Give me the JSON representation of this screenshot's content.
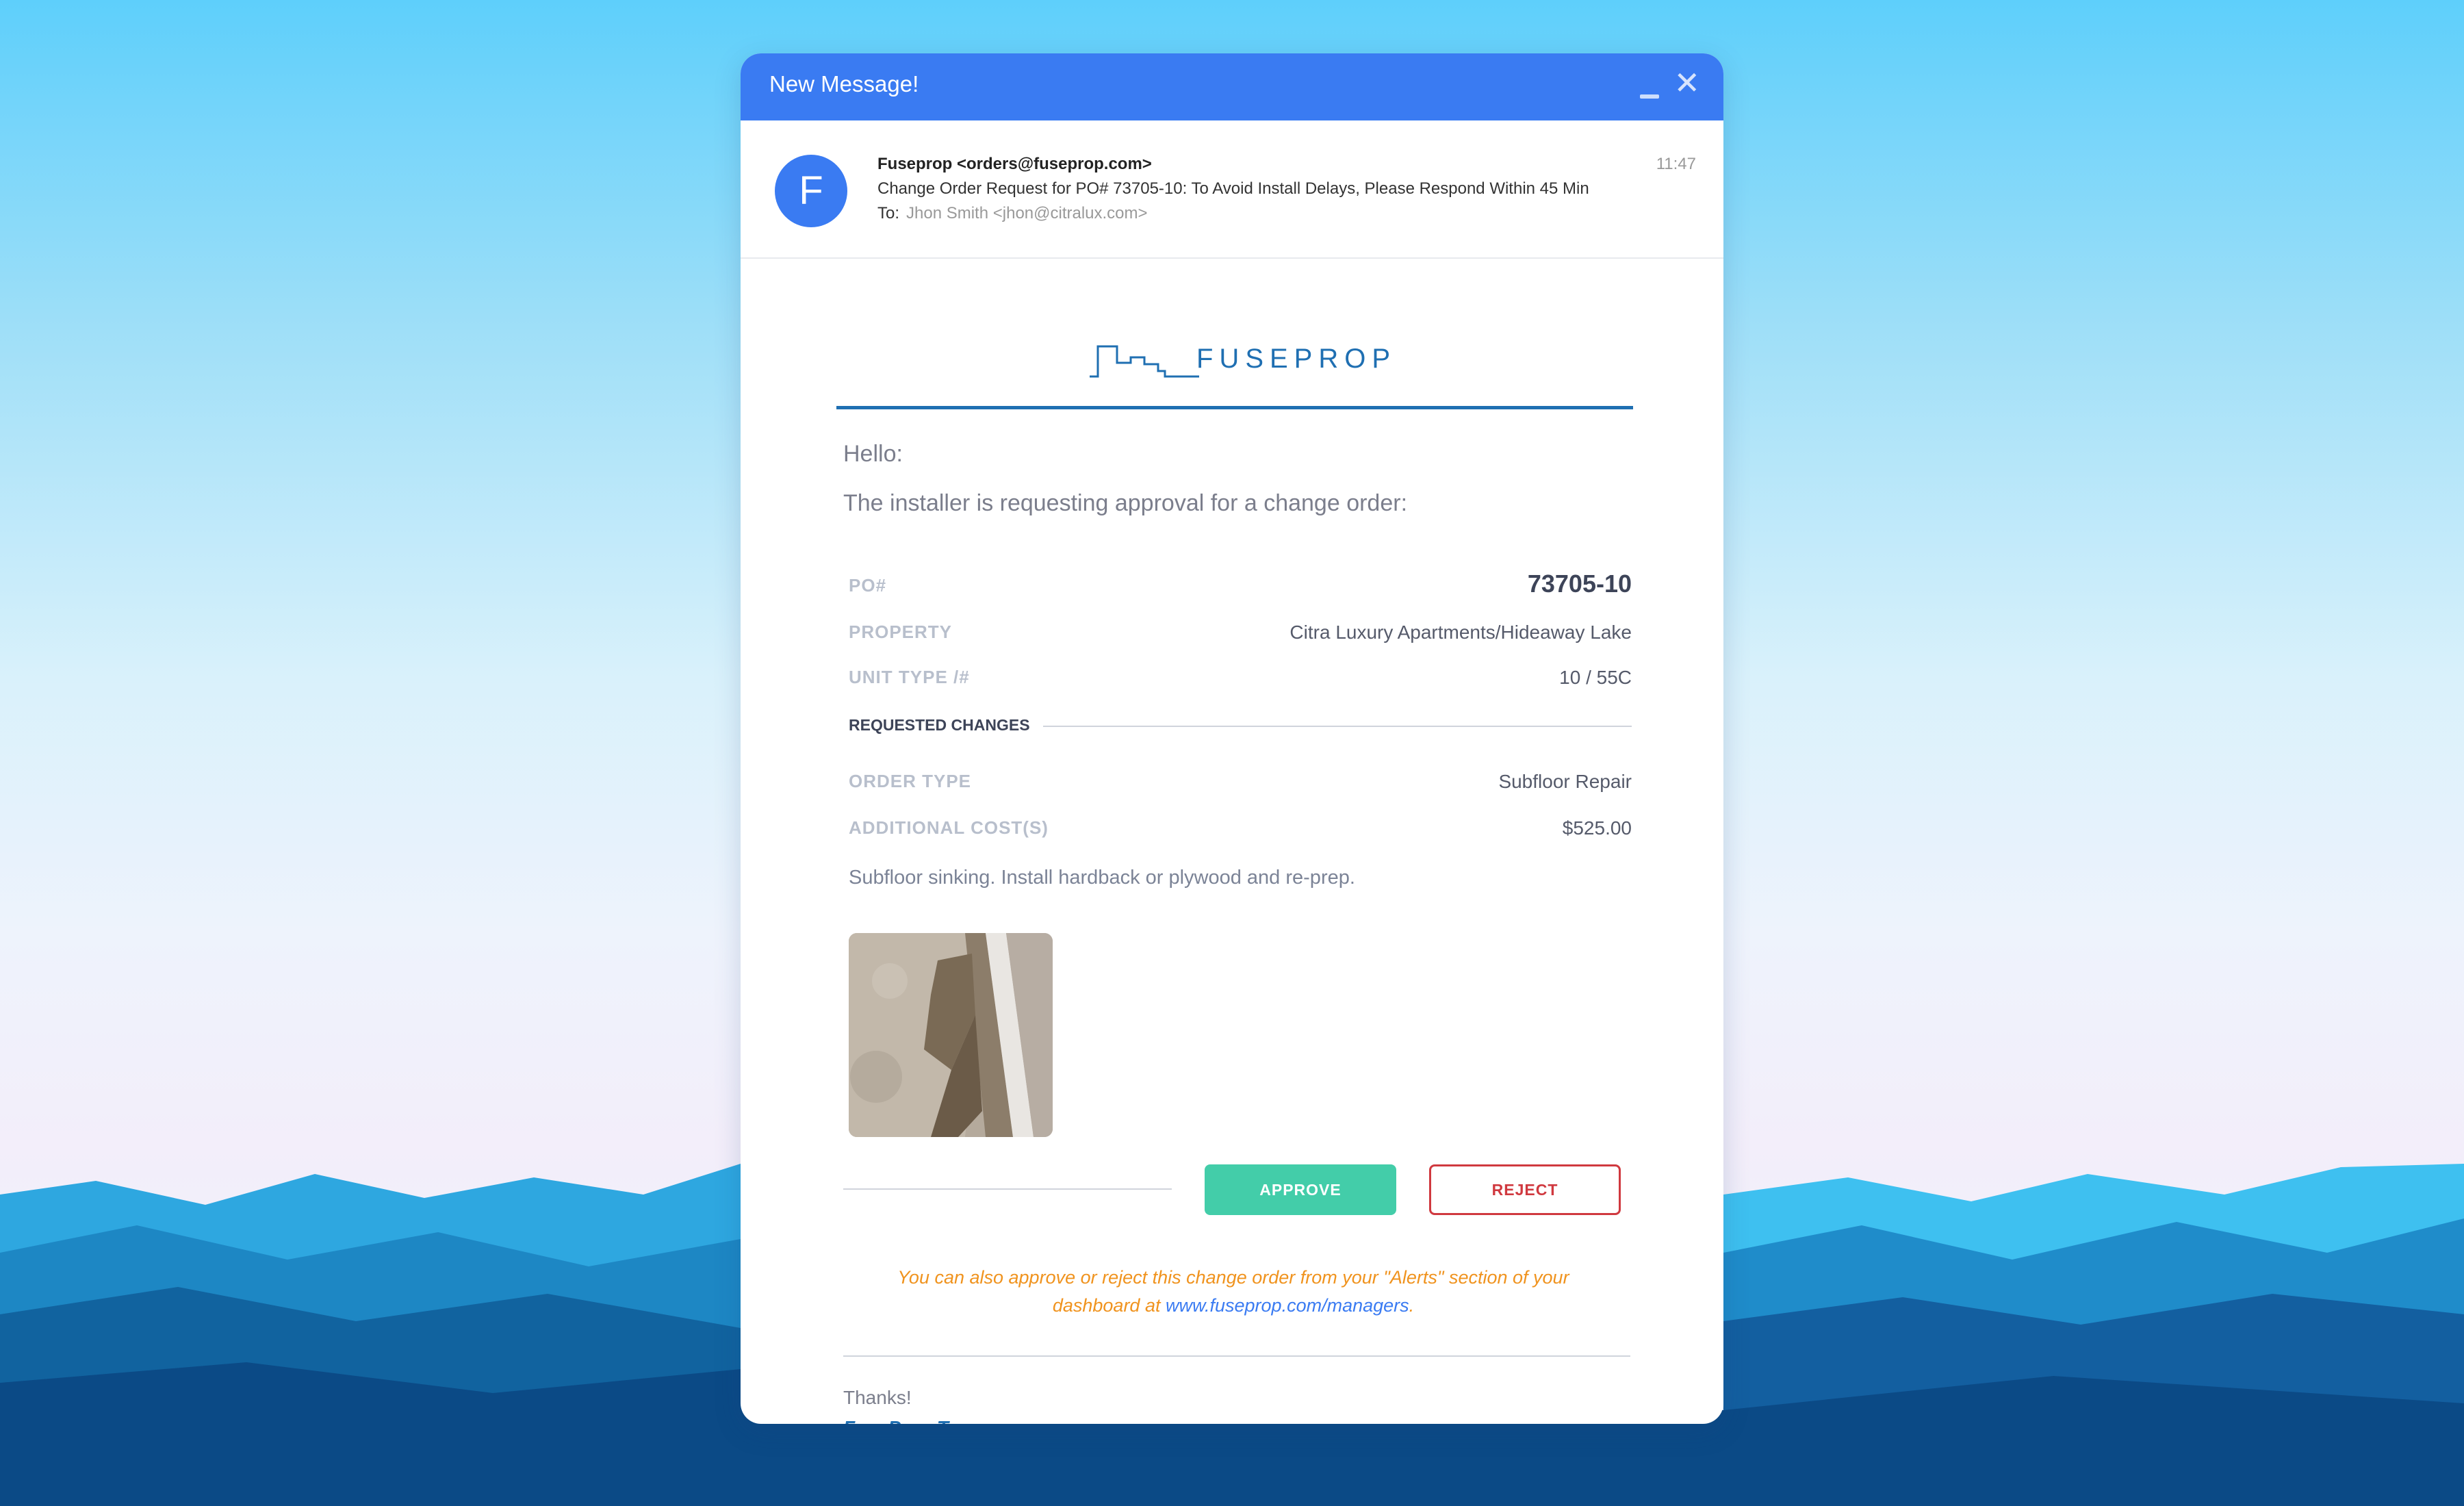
{
  "window": {
    "title": "New Message!",
    "minimize_icon": "minimize-icon",
    "close_icon": "close-icon"
  },
  "email": {
    "avatar_letter": "F",
    "sender": "Fuseprop <orders@fuseprop.com>",
    "subject": "Change Order Request for PO# 73705-10: To Avoid Install Delays, Please Respond Within 45 Min",
    "to_label": "To:",
    "to_value": "Jhon Smith <jhon@citralux.com>",
    "time": "11:47"
  },
  "body": {
    "logo_text": "FUSEPROP",
    "hello": "Hello:",
    "intro": "The installer is requesting approval for a change order:",
    "details": [
      {
        "label": "PO#",
        "value": "73705-10"
      },
      {
        "label": "PROPERTY",
        "value": "Citra Luxury Apartments/Hideaway Lake"
      },
      {
        "label": "UNIT TYPE /#",
        "value": "10 / 55C"
      }
    ],
    "section_title": "REQUESTED CHANGES",
    "changes": [
      {
        "label": "ORDER TYPE",
        "value": "Subfloor Repair"
      },
      {
        "label": "ADDITIONAL COST(S)",
        "value": "$525.00"
      }
    ],
    "description": "Subfloor sinking. Install hardback or plywood and re-prep.",
    "approve_label": "APPROVE",
    "reject_label": "REJECT",
    "note_text": "You can also approve or reject this change order from your \"Alerts\" section of your dashboard at",
    "note_link": "www.fuseprop.com/managers",
    "note_end": ".",
    "thanks": "Thanks!",
    "team": "FuseProp Team"
  },
  "colors": {
    "title_bar": "#3a7bf2",
    "approve": "#43cda9",
    "reject": "#d0393f",
    "note": "#f0931e",
    "brand": "#1f6fb2"
  }
}
